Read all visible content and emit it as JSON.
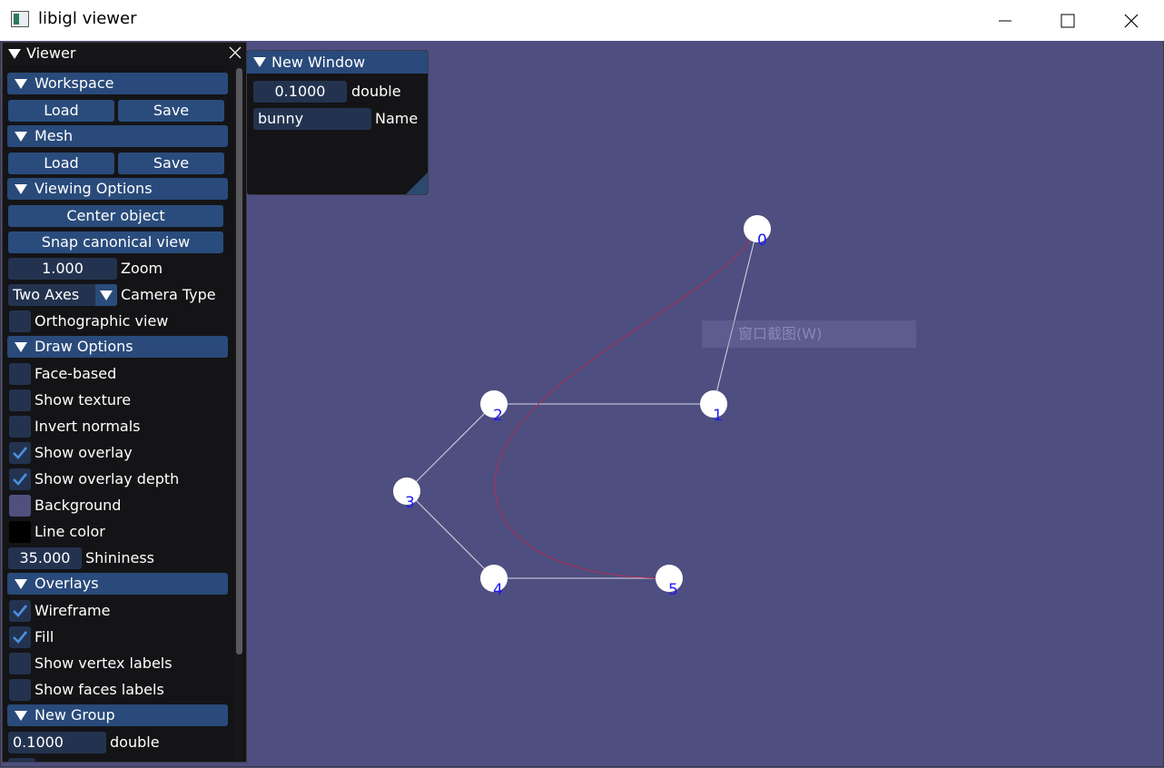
{
  "window": {
    "title": "libigl viewer"
  },
  "viewer_panel": {
    "title": "Viewer",
    "workspace": {
      "header": "Workspace",
      "load": "Load",
      "save": "Save"
    },
    "mesh": {
      "header": "Mesh",
      "load": "Load",
      "save": "Save"
    },
    "viewing_options": {
      "header": "Viewing Options",
      "center_object": "Center object",
      "snap_view": "Snap canonical view",
      "zoom_value": "1.000",
      "zoom_label": "Zoom",
      "camera_type_value": "Two Axes",
      "camera_type_label": "Camera Type",
      "orthographic_label": "Orthographic view",
      "orthographic_checked": false
    },
    "draw_options": {
      "header": "Draw Options",
      "face_based": {
        "label": "Face-based",
        "checked": false
      },
      "show_texture": {
        "label": "Show texture",
        "checked": false
      },
      "invert_normals": {
        "label": "Invert normals",
        "checked": false
      },
      "show_overlay": {
        "label": "Show overlay",
        "checked": true
      },
      "show_overlay_depth": {
        "label": "Show overlay depth",
        "checked": true
      },
      "background": {
        "label": "Background",
        "color": "#50507f"
      },
      "line_color": {
        "label": "Line color",
        "color": "#000000"
      },
      "shininess_value": "35.000",
      "shininess_label": "Shininess"
    },
    "overlays": {
      "header": "Overlays",
      "wireframe": {
        "label": "Wireframe",
        "checked": true
      },
      "fill": {
        "label": "Fill",
        "checked": true
      },
      "show_vertex_labels": {
        "label": "Show vertex labels",
        "checked": false
      },
      "show_faces_labels": {
        "label": "Show faces labels",
        "checked": false
      }
    },
    "new_group": {
      "header": "New Group",
      "double_value": "0.1000",
      "double_label": "double"
    }
  },
  "new_window": {
    "title": "New Window",
    "double_value": "0.1000",
    "double_label": "double",
    "name_value": "bunny",
    "name_label": "Name"
  },
  "ghost_tooltip": "窗口截图(W)",
  "scene": {
    "vertex_labels": [
      "0",
      "1",
      "2",
      "3",
      "4",
      "5"
    ],
    "vertex_color": "#ffffff",
    "label_color": "#1a1aff",
    "edge_color": "#d8d8e8",
    "curve_color": "#b03050"
  },
  "colors": {
    "accent": "#294a7a",
    "panel_bg": "#141417",
    "check_mark": "#4a90e2"
  }
}
